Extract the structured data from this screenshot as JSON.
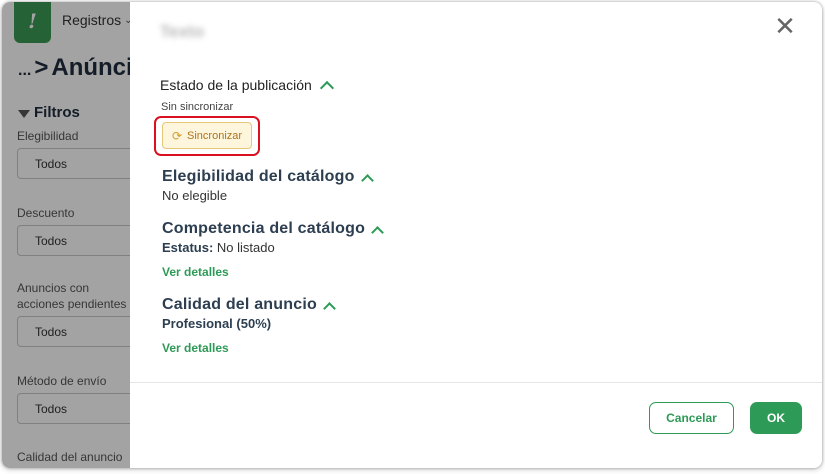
{
  "app": {
    "logo_text": "!",
    "nav_label": "Registros",
    "breadcrumb_ellipsis": "...",
    "breadcrumb_sep": ">",
    "page_title": "Anúnci",
    "filters_title": "Filtros",
    "filters": [
      {
        "label": "Elegibilidad",
        "value": "Todos"
      },
      {
        "label": "Descuento",
        "value": "Todos"
      },
      {
        "label": "Anuncios con acciones pendientes",
        "value": "Todos"
      },
      {
        "label": "Método de envío",
        "value": "Todos"
      },
      {
        "label": "Calidad del anuncio",
        "value": ""
      }
    ]
  },
  "modal": {
    "title": "Texto",
    "close_glyph": "✕",
    "publication": {
      "heading": "Estado de la publicación",
      "status": "Sin sincronizar",
      "sync_label": "Sincronizar"
    },
    "eligibility": {
      "heading": "Elegibilidad del catálogo",
      "value": "No elegible"
    },
    "competition": {
      "heading": "Competencia del catálogo",
      "status_label": "Estatus:",
      "status_value": "No listado",
      "details_link": "Ver detalles"
    },
    "quality": {
      "heading": "Calidad del anuncio",
      "value": "Profesional (50%)",
      "details_link": "Ver detalles"
    },
    "footer": {
      "cancel_label": "Cancelar",
      "ok_label": "OK"
    }
  },
  "colors": {
    "brand_green": "#2e9a57",
    "highlight_red": "#d8101f",
    "sync_bg": "#fdf5dc",
    "sync_text": "#b0741a"
  },
  "icons": {
    "close": "close-icon",
    "sync": "refresh-icon",
    "caret": "chevron-up-icon",
    "nav_caret": "chevron-down-icon",
    "filter": "funnel-icon"
  }
}
